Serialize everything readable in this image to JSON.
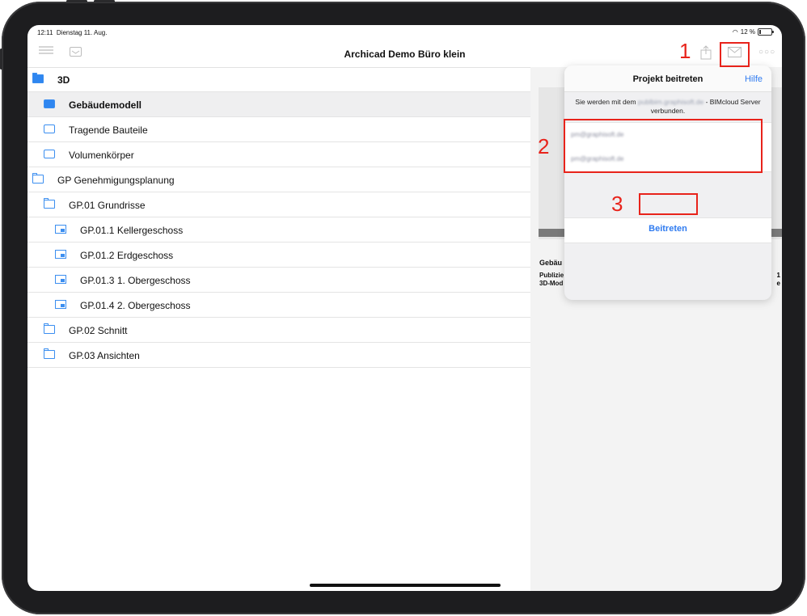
{
  "status": {
    "time": "12:11",
    "date": "Dienstag 11. Aug.",
    "battery": "12 %"
  },
  "navbar": {
    "title": "Archicad Demo Büro klein"
  },
  "list": [
    {
      "label": "3D",
      "icon": "folder-filled-icon",
      "indent": 0,
      "bold": true
    },
    {
      "label": "Gebäudemodell",
      "icon": "cube-filled-icon",
      "indent": 1,
      "selected": true
    },
    {
      "label": "Tragende Bauteile",
      "icon": "cube-icon",
      "indent": 1
    },
    {
      "label": "Volumenkörper",
      "icon": "cube-icon",
      "indent": 1
    },
    {
      "label": "GP Genehmigungsplanung",
      "icon": "folder-icon",
      "indent": 0
    },
    {
      "label": "GP.01 Grundrisse",
      "icon": "folder-icon",
      "indent": 1
    },
    {
      "label": "GP.01.1 Kellergeschoss",
      "icon": "floorplan-icon",
      "indent": 2
    },
    {
      "label": "GP.01.2 Erdgeschoss",
      "icon": "floorplan-icon",
      "indent": 2
    },
    {
      "label": "GP.01.3 1. Obergeschoss",
      "icon": "floorplan-icon",
      "indent": 2
    },
    {
      "label": "GP.01.4 2. Obergeschoss",
      "icon": "floorplan-icon",
      "indent": 2
    },
    {
      "label": "GP.02 Schnitt",
      "icon": "folder-icon",
      "indent": 1
    },
    {
      "label": "GP.03 Ansichten",
      "icon": "folder-icon",
      "indent": 1
    }
  ],
  "preview": {
    "title": "Gebäu",
    "line1": "Publizie",
    "line2": "3D-Mod",
    "edge1": "1",
    "edge2": "e"
  },
  "popover": {
    "title": "Projekt beitreten",
    "help": "Hilfe",
    "message_prefix": "Sie werden mit dem",
    "server_blurred": "publbim.graphisoft.de",
    "message_suffix": "- BIMcloud Server verbunden.",
    "username_blurred": "pm@graphisoft.de",
    "password_blurred": "pm@graphisoft.de",
    "join_label": "Beitreten"
  },
  "annotations": {
    "step1": "1",
    "step2": "2",
    "step3": "3",
    "color": "#e8231b"
  },
  "colors": {
    "accent": "#2f7bf0",
    "bezel": "#1d1d1f"
  }
}
